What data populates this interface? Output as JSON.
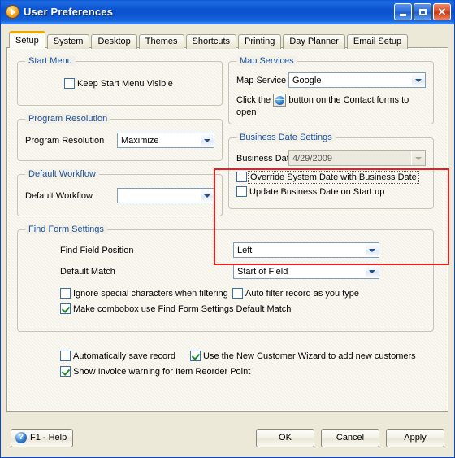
{
  "window": {
    "title": "User Preferences",
    "icon": "app-play-circle-icon",
    "controls": {
      "minimize": "Minimize",
      "maximize": "Maximize",
      "close": "Close"
    }
  },
  "tabs": [
    {
      "label": "Setup",
      "active": true
    },
    {
      "label": "System",
      "active": false
    },
    {
      "label": "Desktop",
      "active": false
    },
    {
      "label": "Themes",
      "active": false
    },
    {
      "label": "Shortcuts",
      "active": false
    },
    {
      "label": "Printing",
      "active": false
    },
    {
      "label": "Day Planner",
      "active": false
    },
    {
      "label": "Email Setup",
      "active": false
    }
  ],
  "start_menu": {
    "legend": "Start Menu",
    "keep_visible": {
      "label": "Keep Start Menu Visible",
      "checked": false
    }
  },
  "program_resolution": {
    "legend": "Program Resolution",
    "field_label": "Program Resolution",
    "value": "Maximize"
  },
  "default_workflow": {
    "legend": "Default Workflow",
    "field_label": "Default Workflow",
    "value": ""
  },
  "map_services": {
    "legend": "Map Services",
    "field_label": "Map Service",
    "value": "Google",
    "hint_before": "Click the",
    "hint_after": "button on the Contact forms to open",
    "icon": "globe-icon"
  },
  "business_date": {
    "legend": "Business Date Settings",
    "field_label": "Business Date",
    "value": "4/29/2009",
    "disabled": true,
    "override": {
      "label": "Override System Date with Business Date",
      "checked": false,
      "focused": true
    },
    "update_startup": {
      "label": "Update Business Date on Start up",
      "checked": false
    }
  },
  "find_form": {
    "legend": "Find Form Settings",
    "position_label": "Find Field Position",
    "position_value": "Left",
    "match_label": "Default Match",
    "match_value": "Start of Field",
    "ignore_special": {
      "label": "Ignore special characters when filtering",
      "checked": false
    },
    "auto_filter": {
      "label": "Auto filter record as you type",
      "checked": false
    },
    "combobox_default": {
      "label": "Make combobox use Find Form Settings Default Match",
      "checked": true
    }
  },
  "misc": {
    "auto_save": {
      "label": "Automatically save record",
      "checked": false
    },
    "customer_wizard": {
      "label": "Use the New Customer Wizard to add new customers",
      "checked": true
    },
    "invoice_warning": {
      "label": "Show Invoice warning for Item Reorder Point",
      "checked": true
    }
  },
  "footer": {
    "help": "F1 - Help",
    "help_icon": "?",
    "ok": "OK",
    "cancel": "Cancel",
    "apply": "Apply"
  },
  "annotation": {
    "color": "#ee1c1c",
    "target": "business-date-settings"
  }
}
